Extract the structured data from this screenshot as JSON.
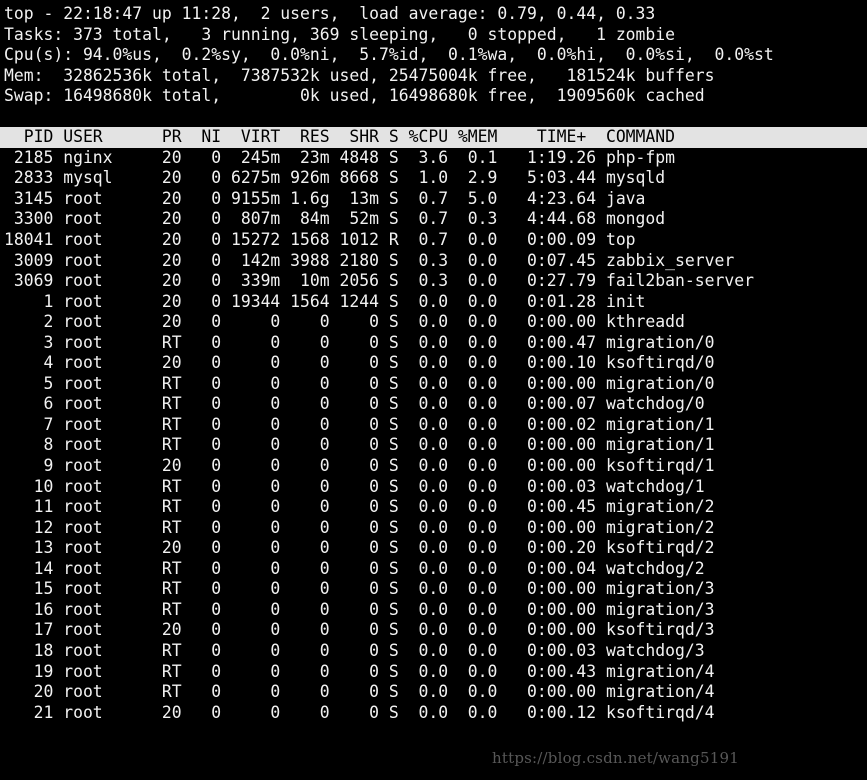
{
  "terminal": {
    "background_color": "#000000",
    "foreground_color": "#f2f2f2",
    "header_background_color": "#e3e3e3",
    "header_foreground_color": "#000000"
  },
  "summary": {
    "uptime_line": "top - 22:18:47 up 11:28,  2 users,  load average: 0.79, 0.44, 0.33",
    "tasks_line": "Tasks: 373 total,   3 running, 369 sleeping,   0 stopped,   1 zombie",
    "cpu_line": "Cpu(s): 94.0%us,  0.2%sy,  0.0%ni,  5.7%id,  0.1%wa,  0.0%hi,  0.0%si,  0.0%st",
    "mem_line": "Mem:  32862536k total,  7387532k used, 25475004k free,   181524k buffers",
    "swap_line": "Swap: 16498680k total,        0k used, 16498680k free,  1909560k cached",
    "fields": {
      "program": "top",
      "time": "22:18:47",
      "uptime": "11:28",
      "users": "2",
      "load_average_1m": "0.79",
      "load_average_5m": "0.44",
      "load_average_15m": "0.33",
      "tasks_total": "373",
      "tasks_running": "3",
      "tasks_sleeping": "369",
      "tasks_stopped": "0",
      "tasks_zombie": "1",
      "cpu_us": "94.0",
      "cpu_sy": "0.2",
      "cpu_ni": "0.0",
      "cpu_id": "5.7",
      "cpu_wa": "0.1",
      "cpu_hi": "0.0",
      "cpu_si": "0.0",
      "cpu_st": "0.0",
      "mem_total": "32862536k",
      "mem_used": "7387532k",
      "mem_free": "25475004k",
      "mem_buffers": "181524k",
      "swap_total": "16498680k",
      "swap_used": "0k",
      "swap_free": "16498680k",
      "swap_cached": "1909560k"
    }
  },
  "table": {
    "header_line": "  PID USER      PR  NI  VIRT  RES  SHR S %CPU %MEM    TIME+  COMMAND",
    "columns": [
      "PID",
      "USER",
      "PR",
      "NI",
      "VIRT",
      "RES",
      "SHR",
      "S",
      "%CPU",
      "%MEM",
      "TIME+",
      "COMMAND"
    ],
    "rows": [
      {
        "line": " 2185 nginx     20   0  245m  23m 4848 S  3.6  0.1   1:19.26 php-fpm",
        "PID": "2185",
        "USER": "nginx",
        "PR": "20",
        "NI": "0",
        "VIRT": "245m",
        "RES": "23m",
        "SHR": "4848",
        "S": "S",
        "CPU": "3.6",
        "MEM": "0.1",
        "TIME": "1:19.26",
        "COMMAND": "php-fpm"
      },
      {
        "line": " 2833 mysql     20   0 6275m 926m 8668 S  1.0  2.9   5:03.44 mysqld",
        "PID": "2833",
        "USER": "mysql",
        "PR": "20",
        "NI": "0",
        "VIRT": "6275m",
        "RES": "926m",
        "SHR": "8668",
        "S": "S",
        "CPU": "1.0",
        "MEM": "2.9",
        "TIME": "5:03.44",
        "COMMAND": "mysqld"
      },
      {
        "line": " 3145 root      20   0 9155m 1.6g  13m S  0.7  5.0   4:23.64 java",
        "PID": "3145",
        "USER": "root",
        "PR": "20",
        "NI": "0",
        "VIRT": "9155m",
        "RES": "1.6g",
        "SHR": "13m",
        "S": "S",
        "CPU": "0.7",
        "MEM": "5.0",
        "TIME": "4:23.64",
        "COMMAND": "java"
      },
      {
        "line": " 3300 root      20   0  807m  84m  52m S  0.7  0.3   4:44.68 mongod",
        "PID": "3300",
        "USER": "root",
        "PR": "20",
        "NI": "0",
        "VIRT": "807m",
        "RES": "84m",
        "SHR": "52m",
        "S": "S",
        "CPU": "0.7",
        "MEM": "0.3",
        "TIME": "4:44.68",
        "COMMAND": "mongod"
      },
      {
        "line": "18041 root      20   0 15272 1568 1012 R  0.7  0.0   0:00.09 top",
        "PID": "18041",
        "USER": "root",
        "PR": "20",
        "NI": "0",
        "VIRT": "15272",
        "RES": "1568",
        "SHR": "1012",
        "S": "R",
        "CPU": "0.7",
        "MEM": "0.0",
        "TIME": "0:00.09",
        "COMMAND": "top"
      },
      {
        "line": " 3009 root      20   0  142m 3988 2180 S  0.3  0.0   0:07.45 zabbix_server",
        "PID": "3009",
        "USER": "root",
        "PR": "20",
        "NI": "0",
        "VIRT": "142m",
        "RES": "3988",
        "SHR": "2180",
        "S": "S",
        "CPU": "0.3",
        "MEM": "0.0",
        "TIME": "0:07.45",
        "COMMAND": "zabbix_server"
      },
      {
        "line": " 3069 root      20   0  339m  10m 2056 S  0.3  0.0   0:27.79 fail2ban-server",
        "PID": "3069",
        "USER": "root",
        "PR": "20",
        "NI": "0",
        "VIRT": "339m",
        "RES": "10m",
        "SHR": "2056",
        "S": "S",
        "CPU": "0.3",
        "MEM": "0.0",
        "TIME": "0:27.79",
        "COMMAND": "fail2ban-server"
      },
      {
        "line": "    1 root      20   0 19344 1564 1244 S  0.0  0.0   0:01.28 init",
        "PID": "1",
        "USER": "root",
        "PR": "20",
        "NI": "0",
        "VIRT": "19344",
        "RES": "1564",
        "SHR": "1244",
        "S": "S",
        "CPU": "0.0",
        "MEM": "0.0",
        "TIME": "0:01.28",
        "COMMAND": "init"
      },
      {
        "line": "    2 root      20   0     0    0    0 S  0.0  0.0   0:00.00 kthreadd",
        "PID": "2",
        "USER": "root",
        "PR": "20",
        "NI": "0",
        "VIRT": "0",
        "RES": "0",
        "SHR": "0",
        "S": "S",
        "CPU": "0.0",
        "MEM": "0.0",
        "TIME": "0:00.00",
        "COMMAND": "kthreadd"
      },
      {
        "line": "    3 root      RT   0     0    0    0 S  0.0  0.0   0:00.47 migration/0",
        "PID": "3",
        "USER": "root",
        "PR": "RT",
        "NI": "0",
        "VIRT": "0",
        "RES": "0",
        "SHR": "0",
        "S": "S",
        "CPU": "0.0",
        "MEM": "0.0",
        "TIME": "0:00.47",
        "COMMAND": "migration/0"
      },
      {
        "line": "    4 root      20   0     0    0    0 S  0.0  0.0   0:00.10 ksoftirqd/0",
        "PID": "4",
        "USER": "root",
        "PR": "20",
        "NI": "0",
        "VIRT": "0",
        "RES": "0",
        "SHR": "0",
        "S": "S",
        "CPU": "0.0",
        "MEM": "0.0",
        "TIME": "0:00.10",
        "COMMAND": "ksoftirqd/0"
      },
      {
        "line": "    5 root      RT   0     0    0    0 S  0.0  0.0   0:00.00 migration/0",
        "PID": "5",
        "USER": "root",
        "PR": "RT",
        "NI": "0",
        "VIRT": "0",
        "RES": "0",
        "SHR": "0",
        "S": "S",
        "CPU": "0.0",
        "MEM": "0.0",
        "TIME": "0:00.00",
        "COMMAND": "migration/0"
      },
      {
        "line": "    6 root      RT   0     0    0    0 S  0.0  0.0   0:00.07 watchdog/0",
        "PID": "6",
        "USER": "root",
        "PR": "RT",
        "NI": "0",
        "VIRT": "0",
        "RES": "0",
        "SHR": "0",
        "S": "S",
        "CPU": "0.0",
        "MEM": "0.0",
        "TIME": "0:00.07",
        "COMMAND": "watchdog/0"
      },
      {
        "line": "    7 root      RT   0     0    0    0 S  0.0  0.0   0:00.02 migration/1",
        "PID": "7",
        "USER": "root",
        "PR": "RT",
        "NI": "0",
        "VIRT": "0",
        "RES": "0",
        "SHR": "0",
        "S": "S",
        "CPU": "0.0",
        "MEM": "0.0",
        "TIME": "0:00.02",
        "COMMAND": "migration/1"
      },
      {
        "line": "    8 root      RT   0     0    0    0 S  0.0  0.0   0:00.00 migration/1",
        "PID": "8",
        "USER": "root",
        "PR": "RT",
        "NI": "0",
        "VIRT": "0",
        "RES": "0",
        "SHR": "0",
        "S": "S",
        "CPU": "0.0",
        "MEM": "0.0",
        "TIME": "0:00.00",
        "COMMAND": "migration/1"
      },
      {
        "line": "    9 root      20   0     0    0    0 S  0.0  0.0   0:00.00 ksoftirqd/1",
        "PID": "9",
        "USER": "root",
        "PR": "20",
        "NI": "0",
        "VIRT": "0",
        "RES": "0",
        "SHR": "0",
        "S": "S",
        "CPU": "0.0",
        "MEM": "0.0",
        "TIME": "0:00.00",
        "COMMAND": "ksoftirqd/1"
      },
      {
        "line": "   10 root      RT   0     0    0    0 S  0.0  0.0   0:00.03 watchdog/1",
        "PID": "10",
        "USER": "root",
        "PR": "RT",
        "NI": "0",
        "VIRT": "0",
        "RES": "0",
        "SHR": "0",
        "S": "S",
        "CPU": "0.0",
        "MEM": "0.0",
        "TIME": "0:00.03",
        "COMMAND": "watchdog/1"
      },
      {
        "line": "   11 root      RT   0     0    0    0 S  0.0  0.0   0:00.45 migration/2",
        "PID": "11",
        "USER": "root",
        "PR": "RT",
        "NI": "0",
        "VIRT": "0",
        "RES": "0",
        "SHR": "0",
        "S": "S",
        "CPU": "0.0",
        "MEM": "0.0",
        "TIME": "0:00.45",
        "COMMAND": "migration/2"
      },
      {
        "line": "   12 root      RT   0     0    0    0 S  0.0  0.0   0:00.00 migration/2",
        "PID": "12",
        "USER": "root",
        "PR": "RT",
        "NI": "0",
        "VIRT": "0",
        "RES": "0",
        "SHR": "0",
        "S": "S",
        "CPU": "0.0",
        "MEM": "0.0",
        "TIME": "0:00.00",
        "COMMAND": "migration/2"
      },
      {
        "line": "   13 root      20   0     0    0    0 S  0.0  0.0   0:00.20 ksoftirqd/2",
        "PID": "13",
        "USER": "root",
        "PR": "20",
        "NI": "0",
        "VIRT": "0",
        "RES": "0",
        "SHR": "0",
        "S": "S",
        "CPU": "0.0",
        "MEM": "0.0",
        "TIME": "0:00.20",
        "COMMAND": "ksoftirqd/2"
      },
      {
        "line": "   14 root      RT   0     0    0    0 S  0.0  0.0   0:00.04 watchdog/2",
        "PID": "14",
        "USER": "root",
        "PR": "RT",
        "NI": "0",
        "VIRT": "0",
        "RES": "0",
        "SHR": "0",
        "S": "S",
        "CPU": "0.0",
        "MEM": "0.0",
        "TIME": "0:00.04",
        "COMMAND": "watchdog/2"
      },
      {
        "line": "   15 root      RT   0     0    0    0 S  0.0  0.0   0:00.00 migration/3",
        "PID": "15",
        "USER": "root",
        "PR": "RT",
        "NI": "0",
        "VIRT": "0",
        "RES": "0",
        "SHR": "0",
        "S": "S",
        "CPU": "0.0",
        "MEM": "0.0",
        "TIME": "0:00.00",
        "COMMAND": "migration/3"
      },
      {
        "line": "   16 root      RT   0     0    0    0 S  0.0  0.0   0:00.00 migration/3",
        "PID": "16",
        "USER": "root",
        "PR": "RT",
        "NI": "0",
        "VIRT": "0",
        "RES": "0",
        "SHR": "0",
        "S": "S",
        "CPU": "0.0",
        "MEM": "0.0",
        "TIME": "0:00.00",
        "COMMAND": "migration/3"
      },
      {
        "line": "   17 root      20   0     0    0    0 S  0.0  0.0   0:00.00 ksoftirqd/3",
        "PID": "17",
        "USER": "root",
        "PR": "20",
        "NI": "0",
        "VIRT": "0",
        "RES": "0",
        "SHR": "0",
        "S": "S",
        "CPU": "0.0",
        "MEM": "0.0",
        "TIME": "0:00.00",
        "COMMAND": "ksoftirqd/3"
      },
      {
        "line": "   18 root      RT   0     0    0    0 S  0.0  0.0   0:00.03 watchdog/3",
        "PID": "18",
        "USER": "root",
        "PR": "RT",
        "NI": "0",
        "VIRT": "0",
        "RES": "0",
        "SHR": "0",
        "S": "S",
        "CPU": "0.0",
        "MEM": "0.0",
        "TIME": "0:00.03",
        "COMMAND": "watchdog/3"
      },
      {
        "line": "   19 root      RT   0     0    0    0 S  0.0  0.0   0:00.43 migration/4",
        "PID": "19",
        "USER": "root",
        "PR": "RT",
        "NI": "0",
        "VIRT": "0",
        "RES": "0",
        "SHR": "0",
        "S": "S",
        "CPU": "0.0",
        "MEM": "0.0",
        "TIME": "0:00.43",
        "COMMAND": "migration/4"
      },
      {
        "line": "   20 root      RT   0     0    0    0 S  0.0  0.0   0:00.00 migration/4",
        "PID": "20",
        "USER": "root",
        "PR": "RT",
        "NI": "0",
        "VIRT": "0",
        "RES": "0",
        "SHR": "0",
        "S": "S",
        "CPU": "0.0",
        "MEM": "0.0",
        "TIME": "0:00.00",
        "COMMAND": "migration/4"
      },
      {
        "line": "   21 root      20   0     0    0    0 S  0.0  0.0   0:00.12 ksoftirqd/4",
        "PID": "21",
        "USER": "root",
        "PR": "20",
        "NI": "0",
        "VIRT": "0",
        "RES": "0",
        "SHR": "0",
        "S": "S",
        "CPU": "0.0",
        "MEM": "0.0",
        "TIME": "0:00.12",
        "COMMAND": "ksoftirqd/4"
      }
    ]
  },
  "watermark": {
    "text": "https://blog.csdn.net/wang5191"
  }
}
